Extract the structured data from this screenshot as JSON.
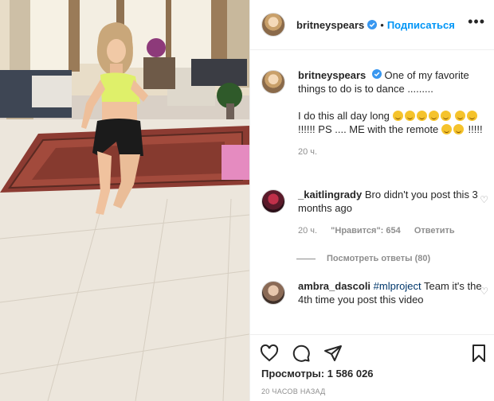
{
  "post": {
    "username": "britneyspears",
    "separator": "•",
    "follow_label": "Подписаться",
    "more_label": "•••",
    "caption": {
      "username": "britneyspears",
      "text_1": "One of my favorite things to do is to dance .........",
      "text_2": "I do this all day long",
      "text_3": "!!!!!! PS .... ME with the remote",
      "text_4": "!!!!!",
      "time": "20 ч."
    },
    "comments": [
      {
        "username": "_kaitlingrady",
        "text": "Bro didn't you post this 3 months ago",
        "time": "20 ч.",
        "likes": "\"Нравится\": 654",
        "reply_label": "Ответить",
        "view_replies": "Посмотреть ответы (80)"
      },
      {
        "username": "ambra_dascoli",
        "hashtag": "#mlproject",
        "text": "Team it's the 4th time you post this video"
      }
    ],
    "views_label": "Просмотры: 1 586 026",
    "posted": "20 ЧАСОВ НАЗАД",
    "icons": {
      "like": "heart-icon",
      "comment": "comment-icon",
      "share": "paper-plane-icon",
      "save": "bookmark-icon",
      "verified": "verified-badge-icon"
    },
    "colors": {
      "link": "#0095f6",
      "verified": "#3897f0",
      "muted": "#8e8e8e"
    }
  }
}
